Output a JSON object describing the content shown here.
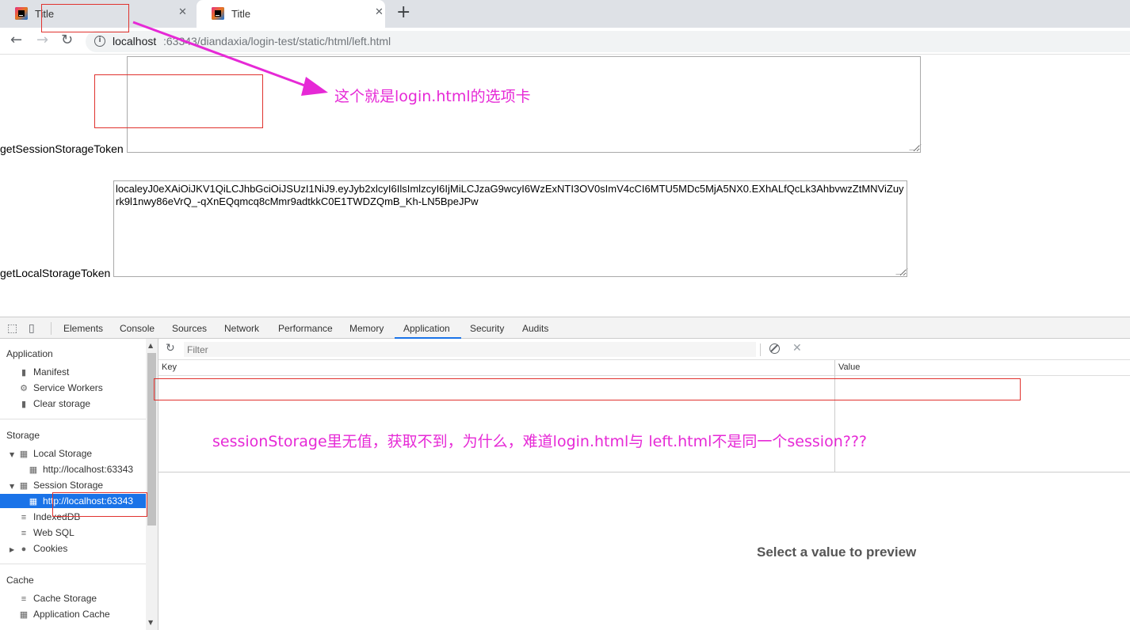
{
  "browser": {
    "tabs": [
      {
        "title": "Title",
        "close": "✕"
      },
      {
        "title": "Title",
        "close": "✕"
      }
    ],
    "new_tab": "+",
    "url_host": "localhost",
    "url_rest": ":63343/diandaxia/login-test/static/html/left.html"
  },
  "page": {
    "session_label": "getSessionStorageToken",
    "session_value": "",
    "local_label": "getLocalStorageToken",
    "local_value": "localeyJ0eXAiOiJKV1QiLCJhbGciOiJSUzI1NiJ9.eyJyb2xlcyI6IlsImlzcyI6IjMiLCJzaG9wcyI6WzExNTI3OV0sImV4cCI6MTU5MDc5MjA5NX0.EXhALfQcLk3AhbvwzZtMNViZuyrk9l1nwy86eVrQ_-qXnEQqmcq8cMmr9adtkkC0E1TWDZQmB_Kh-LN5BpeJPw"
  },
  "annotations": {
    "tab_note": "这个就是login.html的选项卡",
    "session_note": "sessionStorage里无值，获取不到，为什么，难道login.html与 left.html不是同一个session???",
    "arrow_color": "#e629d6",
    "box_color": "#e0322e"
  },
  "devtools": {
    "tabs": [
      "Elements",
      "Console",
      "Sources",
      "Network",
      "Performance",
      "Memory",
      "Application",
      "Security",
      "Audits"
    ],
    "active_tab": "Application",
    "sidebar": {
      "application_header": "Application",
      "application_items": [
        "Manifest",
        "Service Workers",
        "Clear storage"
      ],
      "storage_header": "Storage",
      "local_storage": "Local Storage",
      "local_storage_origin": "http://localhost:63343",
      "session_storage": "Session Storage",
      "session_storage_origin": "http://localhost:63343",
      "indexeddb": "IndexedDB",
      "websql": "Web SQL",
      "cookies": "Cookies",
      "cache_header": "Cache",
      "cache_items": [
        "Cache Storage",
        "Application Cache"
      ]
    },
    "filter_placeholder": "Filter",
    "columns": {
      "key": "Key",
      "value": "Value"
    },
    "preview_text": "Select a value to preview",
    "accent": "#1a73e8"
  }
}
